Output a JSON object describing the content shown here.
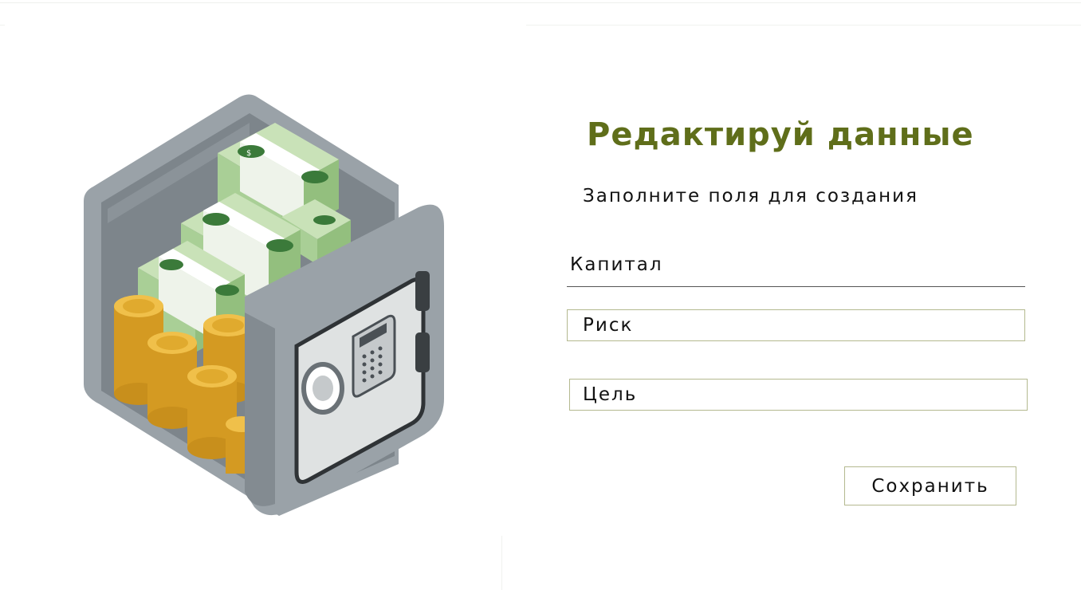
{
  "form": {
    "title": "Редактируй данные",
    "subtitle": "Заполните поля для создания",
    "fields": {
      "capital": "Капитал",
      "risk": "Риск",
      "goal": "Цель"
    },
    "save_label": "Сохранить"
  },
  "illustration": {
    "icon": "safe-with-money-icon",
    "currency_symbol": "$"
  },
  "colors": {
    "title": "#5f6e1a",
    "field_border": "#b4b98f",
    "safe_body": "#9aa2a8",
    "safe_dark": "#7d858b",
    "safe_door": "#dfe2e2",
    "coin": "#e7b43a",
    "money": "#a9cf96"
  }
}
